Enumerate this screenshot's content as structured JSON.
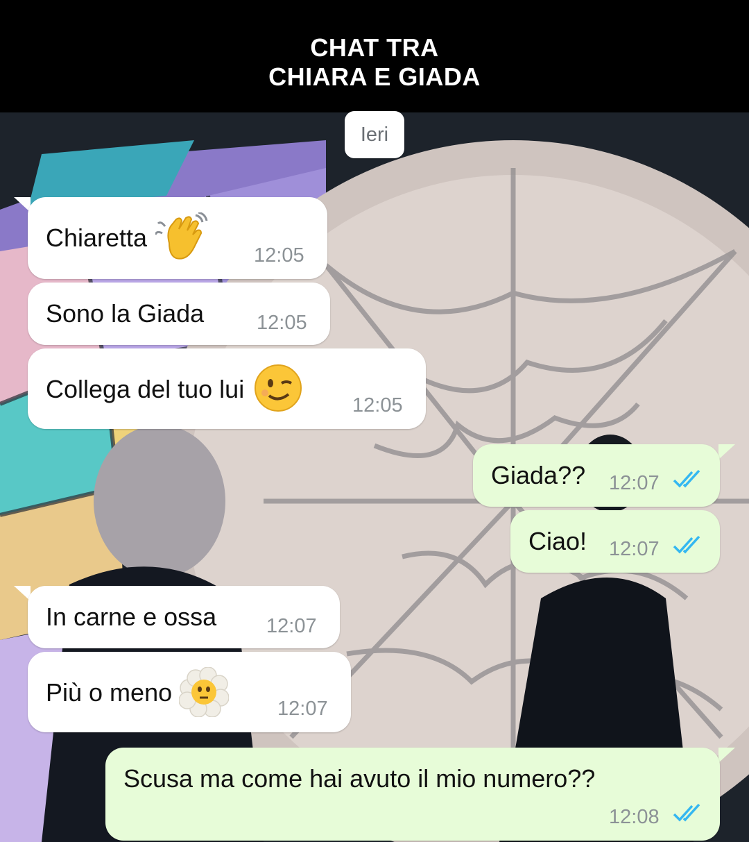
{
  "header": {
    "line1": "CHAT TRA",
    "line2": "CHIARA E GIADA"
  },
  "date_chip": "Ieri",
  "messages": [
    {
      "side": "in",
      "text": "Chiaretta",
      "emoji": "waving-hand-emoji",
      "time": "12:05"
    },
    {
      "side": "in",
      "text": "Sono la Giada",
      "time": "12:05"
    },
    {
      "side": "in",
      "text": "Collega del tuo lui",
      "emoji": "winking-face-emoji",
      "time": "12:05"
    },
    {
      "side": "out",
      "text": "Giada??",
      "time": "12:07",
      "status": "read"
    },
    {
      "side": "out",
      "text": "Ciao!",
      "time": "12:07",
      "status": "read"
    },
    {
      "side": "in",
      "text": "In carne e ossa",
      "time": "12:07"
    },
    {
      "side": "in",
      "text": "Più o meno",
      "emoji": "face-in-clouds-emoji",
      "time": "12:07"
    },
    {
      "side": "out",
      "text": "Scusa ma come hai avuto il mio numero??",
      "time": "12:08",
      "status": "read"
    }
  ],
  "colors": {
    "incoming_bubble": "#ffffff",
    "outgoing_bubble": "#e7fcd8",
    "read_ticks": "#34b7f1",
    "timestamp": "#8c9296"
  }
}
